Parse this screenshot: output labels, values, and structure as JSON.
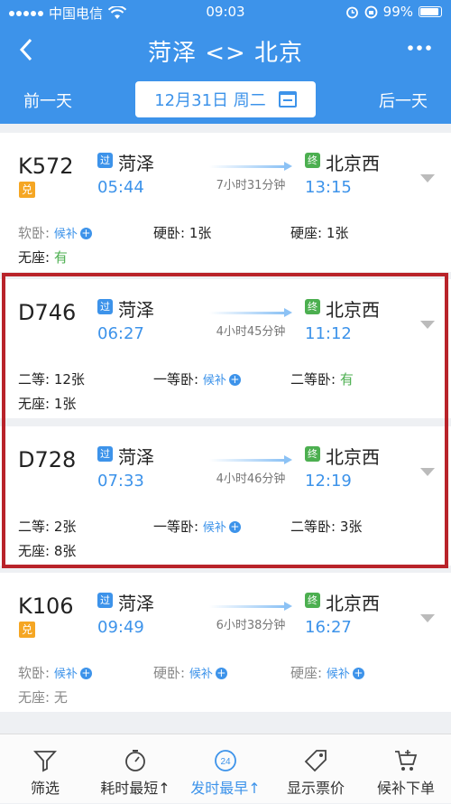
{
  "status_bar": {
    "carrier": "中国电信",
    "time": "09:03",
    "battery": "99%"
  },
  "nav": {
    "title": "菏泽 <> 北京"
  },
  "date_bar": {
    "prev": "前一天",
    "date": "12月31日 周二",
    "next": "后一天"
  },
  "trains": [
    {
      "no": "K572",
      "badge": "兑",
      "from_tag": "过",
      "from": "菏泽",
      "dep": "05:44",
      "duration": "7小时31分钟",
      "to_tag": "终",
      "to": "北京西",
      "arr": "13:15",
      "seats": [
        {
          "name": "软卧:",
          "value": "候补",
          "style": "blue",
          "plus": "+"
        },
        {
          "name": "硬卧:",
          "value": "1张",
          "style": ""
        },
        {
          "name": "硬座:",
          "value": "1张",
          "style": ""
        },
        {
          "name": "无座:",
          "value": "有",
          "style": "green"
        }
      ]
    },
    {
      "no": "D746",
      "badge": "",
      "from_tag": "过",
      "from": "菏泽",
      "dep": "06:27",
      "duration": "4小时45分钟",
      "to_tag": "终",
      "to": "北京西",
      "arr": "11:12",
      "seats": [
        {
          "name": "二等:",
          "value": "12张",
          "style": ""
        },
        {
          "name": "一等卧:",
          "value": "候补",
          "style": "blue",
          "plus": "+"
        },
        {
          "name": "二等卧:",
          "value": "有",
          "style": "green"
        },
        {
          "name": "无座:",
          "value": "1张",
          "style": ""
        }
      ]
    },
    {
      "no": "D728",
      "badge": "",
      "from_tag": "过",
      "from": "菏泽",
      "dep": "07:33",
      "duration": "4小时46分钟",
      "to_tag": "终",
      "to": "北京西",
      "arr": "12:19",
      "seats": [
        {
          "name": "二等:",
          "value": "2张",
          "style": ""
        },
        {
          "name": "一等卧:",
          "value": "候补",
          "style": "blue",
          "plus": "+"
        },
        {
          "name": "二等卧:",
          "value": "3张",
          "style": ""
        },
        {
          "name": "无座:",
          "value": "8张",
          "style": ""
        }
      ]
    },
    {
      "no": "K106",
      "badge": "兑",
      "from_tag": "过",
      "from": "菏泽",
      "dep": "09:49",
      "duration": "6小时38分钟",
      "to_tag": "终",
      "to": "北京西",
      "arr": "16:27",
      "seats": [
        {
          "name": "软卧:",
          "value": "候补",
          "style": "blue",
          "plus": "+"
        },
        {
          "name": "硬卧:",
          "value": "候补",
          "style": "blue",
          "plus": "+"
        },
        {
          "name": "硬座:",
          "value": "候补",
          "style": "blue",
          "plus": "+"
        },
        {
          "name": "无座:",
          "value": "无",
          "style": "grayval"
        }
      ]
    }
  ],
  "tabs": [
    {
      "label": "筛选",
      "icon": "filter-icon"
    },
    {
      "label": "耗时最短↑",
      "icon": "stopwatch-icon"
    },
    {
      "label": "发时最早↑",
      "icon": "clock24-icon",
      "clock_text": "24"
    },
    {
      "label": "显示票价",
      "icon": "price-tag-icon"
    },
    {
      "label": "候补下单",
      "icon": "cart-icon"
    }
  ],
  "colors": {
    "primary": "#3d93ea",
    "green": "#4caf50",
    "orange": "#f5a623",
    "highlight": "#b9232a"
  }
}
